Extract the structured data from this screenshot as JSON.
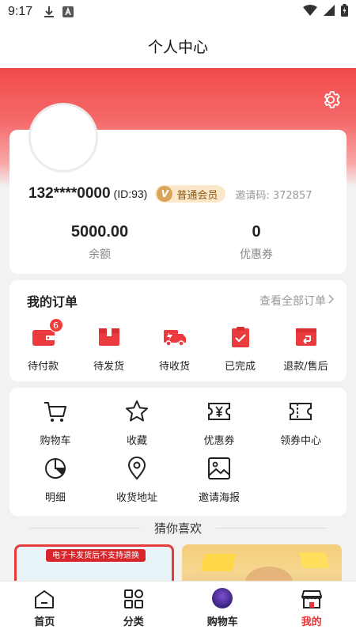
{
  "status_bar": {
    "time": "9:17"
  },
  "title": "个人中心",
  "profile": {
    "phone": "132****0000",
    "user_id": "(ID:93)",
    "member_level": "普通会员",
    "member_badge": "V",
    "invite_code": "邀请码: 372857",
    "balance_value": "5000.00",
    "balance_label": "余额",
    "coupon_value": "0",
    "coupon_label": "优惠券"
  },
  "orders": {
    "title": "我的订单",
    "view_all": "查看全部订单",
    "items": [
      {
        "label": "待付款",
        "icon": "wallet-icon",
        "badge": "6"
      },
      {
        "label": "待发货",
        "icon": "package-icon"
      },
      {
        "label": "待收货",
        "icon": "truck-icon"
      },
      {
        "label": "已完成",
        "icon": "clipboard-check-icon"
      },
      {
        "label": "退款/售后",
        "icon": "refund-icon"
      }
    ]
  },
  "tools": [
    {
      "label": "购物车",
      "icon": "cart-icon"
    },
    {
      "label": "收藏",
      "icon": "star-icon"
    },
    {
      "label": "优惠券",
      "icon": "coupon-icon"
    },
    {
      "label": "领券中心",
      "icon": "ticket-icon"
    },
    {
      "label": "明细",
      "icon": "pie-chart-icon"
    },
    {
      "label": "收货地址",
      "icon": "location-icon"
    },
    {
      "label": "邀请海报",
      "icon": "image-icon"
    }
  ],
  "recommend": {
    "title": "猜你喜欢",
    "products": [
      {
        "banner": "电子卡发货后不支持退换"
      },
      {
        "banner": ""
      }
    ]
  },
  "tabbar": [
    {
      "label": "首页",
      "icon": "home-icon"
    },
    {
      "label": "分类",
      "icon": "category-icon"
    },
    {
      "label": "购物车",
      "icon": "cart-thumb"
    },
    {
      "label": "我的",
      "icon": "shop-icon",
      "active": true
    }
  ],
  "colors": {
    "brand_red": "#e6343a",
    "gold": "#d9a55b"
  }
}
